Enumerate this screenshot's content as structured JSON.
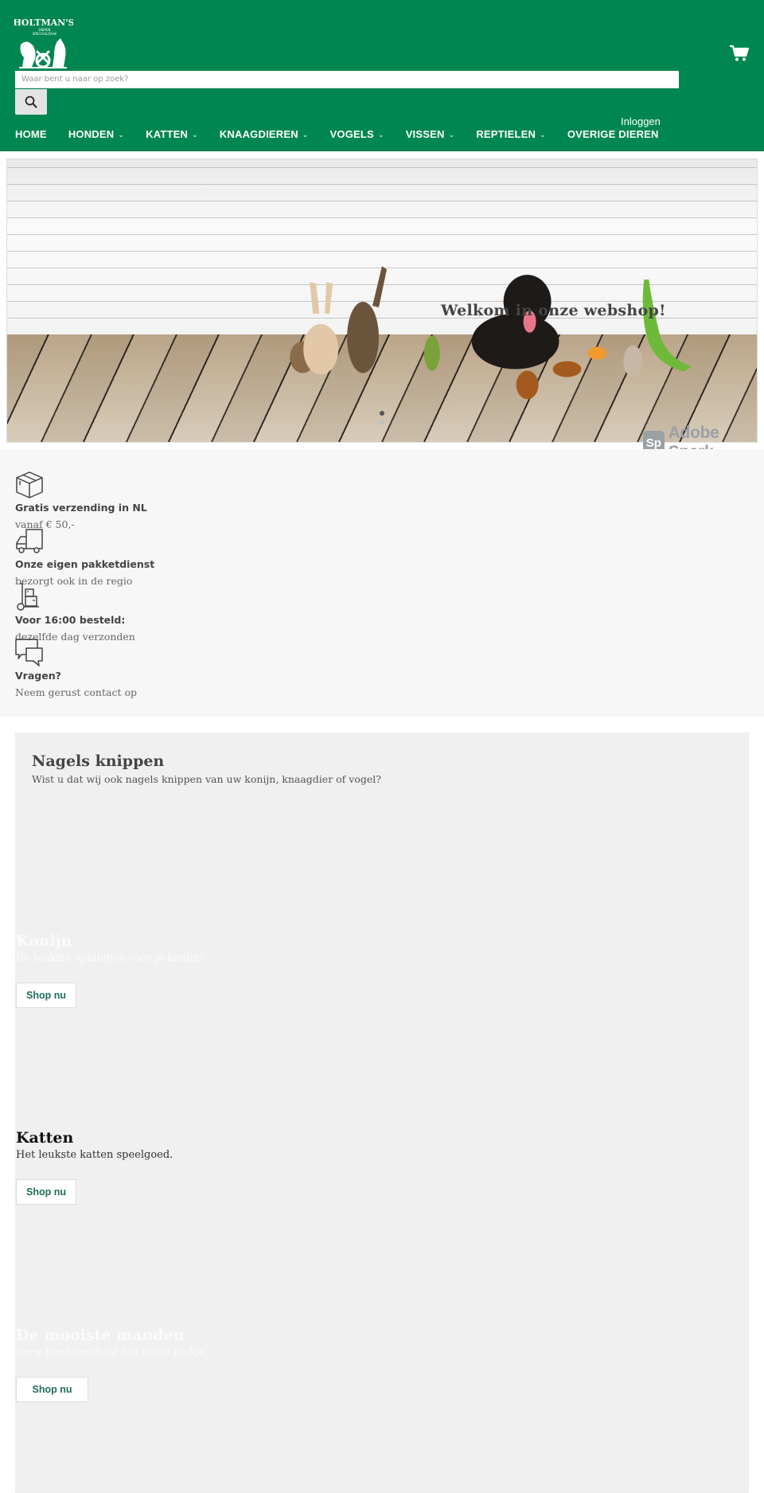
{
  "header": {
    "brand": "HOLTMAN'S",
    "brand_sub_1": "DIEREN",
    "brand_sub_2": "SPECIAALZAAK",
    "search": {
      "placeholder": "Waar bent u naar op zoek?",
      "value": ""
    },
    "nav": [
      {
        "label": "HOME",
        "has_dropdown": false
      },
      {
        "label": "HONDEN",
        "has_dropdown": true
      },
      {
        "label": "KATTEN",
        "has_dropdown": true
      },
      {
        "label": "KNAAGDIEREN",
        "has_dropdown": true
      },
      {
        "label": "VOGELS",
        "has_dropdown": true
      },
      {
        "label": "VISSEN",
        "has_dropdown": true
      },
      {
        "label": "REPTIELEN",
        "has_dropdown": true
      },
      {
        "label": "OVERIGE DIEREN",
        "has_dropdown": false
      }
    ],
    "chevron": "⌄",
    "login_label": "Inloggen",
    "icons": {
      "search": "search-icon",
      "cart": "cart-icon"
    }
  },
  "hero": {
    "title": "Welkom in onze webshop!",
    "slides": 2,
    "active_slide": 1,
    "badge_logo": "Sp",
    "badge_text": "Adobe Spark"
  },
  "features": [
    {
      "icon": "box-icon",
      "title": "Gratis verzending in NL",
      "subtitle": "vanaf € 50,-"
    },
    {
      "icon": "truck-icon",
      "title": "Onze eigen pakketdienst",
      "subtitle": "bezorgt ook in de regio"
    },
    {
      "icon": "hand-truck-icon",
      "title": "Voor 16:00 besteld:",
      "subtitle": "dezelfde dag verzonden"
    },
    {
      "icon": "chat-bubbles-icon",
      "title": "Vragen?",
      "subtitle": "Neem gerust contact op"
    }
  ],
  "promo": {
    "title": "Nagels knippen",
    "subtitle": "Wist u dat wij ook nagels knippen van uw konijn, knaagdier of vogel?",
    "tiles": [
      {
        "title": "Konijn",
        "subtitle": "De leukste spulletjes voor je konijn!",
        "button": "Shop nu"
      },
      {
        "title": "Katten",
        "subtitle": "Het leukste katten speelgoed.",
        "button": "Shop nu"
      },
      {
        "title": "De mooiste manden",
        "subtitle": "Jouw hond verdient het beste plekje.",
        "button": "Shop nu"
      }
    ]
  },
  "colors": {
    "brand_green": "#008651",
    "button_text": "#1e6e5a",
    "features_bg": "#f7f7f7",
    "promo_bg": "#f0f0f0"
  }
}
